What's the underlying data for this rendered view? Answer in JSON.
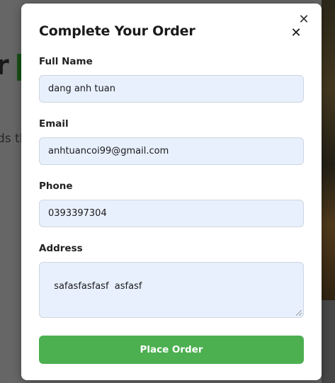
{
  "background": {
    "title_fragment": "r",
    "text_fragment": "ds th"
  },
  "modal": {
    "title": "Complete Your Order",
    "close_glyph_outer": "✕",
    "close_glyph_inner": "✕",
    "fields": {
      "full_name": {
        "label": "Full Name",
        "value": "dang anh tuan"
      },
      "email": {
        "label": "Email",
        "value": "anhtuancoi99@gmail.com"
      },
      "phone": {
        "label": "Phone",
        "value": "0393397304"
      },
      "address": {
        "label": "Address",
        "value": "safasfasfasf  asfasf"
      }
    },
    "submit_label": "Place Order"
  },
  "colors": {
    "button_bg": "#4caf50",
    "input_bg": "#e8f0fe",
    "overlay": "#6a6a6a"
  },
  "icons": {
    "close_outer": "close-icon",
    "close_inner": "close-icon"
  }
}
